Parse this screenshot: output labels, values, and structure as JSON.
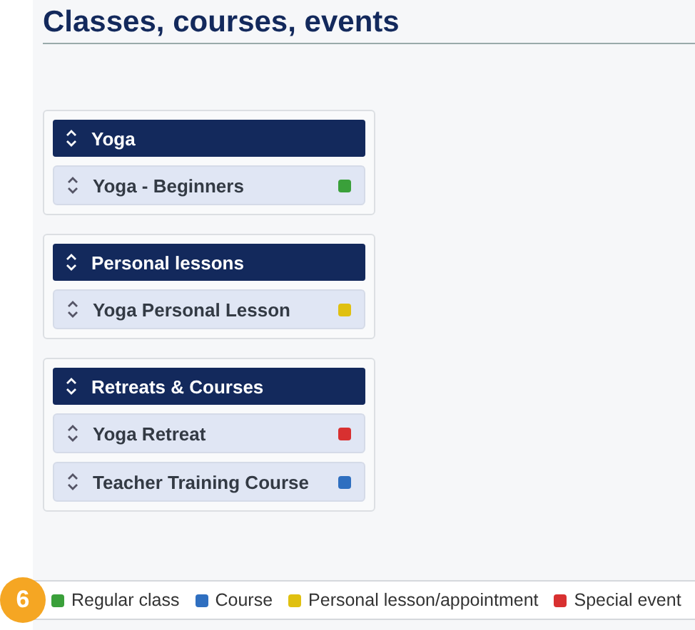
{
  "title": "Classes, courses, events",
  "groups": [
    {
      "name": "Yoga",
      "items": [
        {
          "name": "Yoga - Beginners",
          "color": "#3aa03a"
        }
      ]
    },
    {
      "name": "Personal lessons",
      "items": [
        {
          "name": "Yoga Personal Lesson",
          "color": "#e0c010"
        }
      ]
    },
    {
      "name": "Retreats & Courses",
      "items": [
        {
          "name": "Yoga Retreat",
          "color": "#d83030"
        },
        {
          "name": "Teacher Training Course",
          "color": "#2f6fc0"
        }
      ]
    }
  ],
  "step_badge": "6",
  "legend": [
    {
      "label": "Regular class",
      "color": "#3aa03a"
    },
    {
      "label": "Course",
      "color": "#2f6fc0"
    },
    {
      "label": "Personal lesson/appointment",
      "color": "#e0c010"
    },
    {
      "label": "Special event",
      "color": "#d83030"
    }
  ]
}
